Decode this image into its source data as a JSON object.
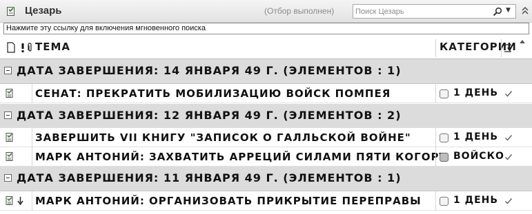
{
  "window": {
    "title": "Цезарь",
    "filter_status": "(Отбор выполнен)",
    "search_placeholder": "Поиск Цезарь",
    "instant_search_link": "Нажмите эту ссылку для включения мгновенного поиска"
  },
  "columns": {
    "subject": "Тема",
    "categories": "Категории",
    "icon_names": [
      "item-type-icon",
      "importance-icon",
      "attachment-icon",
      "flag-status-icon"
    ]
  },
  "groups": [
    {
      "label": "Дата завершения: 14 января 49 г.    (Элементов : 1)",
      "items": [
        {
          "subject": "Сенат: прекратить мобилизацию войск Помпея",
          "category": "1 день",
          "category_filled": false,
          "priority": ""
        }
      ]
    },
    {
      "label": "Дата завершения: 12 января 49 г.    (Элементов : 2)",
      "items": [
        {
          "subject": "Завершить VII книгу \"Записок о Галльской войне\"",
          "category": "1 день",
          "category_filled": false,
          "priority": ""
        },
        {
          "subject": "Марк Антоний: Захватить Арреций силами пяти когорт",
          "category": "войско",
          "category_filled": true,
          "priority": ""
        }
      ]
    },
    {
      "label": "Дата завершения: 11 января 49 г.    (Элементов : 1)",
      "items": [
        {
          "subject": "Марк Антоний: организовать прикрытие переправы",
          "category": "1 день",
          "category_filled": false,
          "priority": "low"
        }
      ]
    }
  ],
  "colors": {
    "group_background": "#dcdcdc",
    "titlebar_background": "#e9e9e9",
    "grid_line": "#d6d6d6"
  }
}
